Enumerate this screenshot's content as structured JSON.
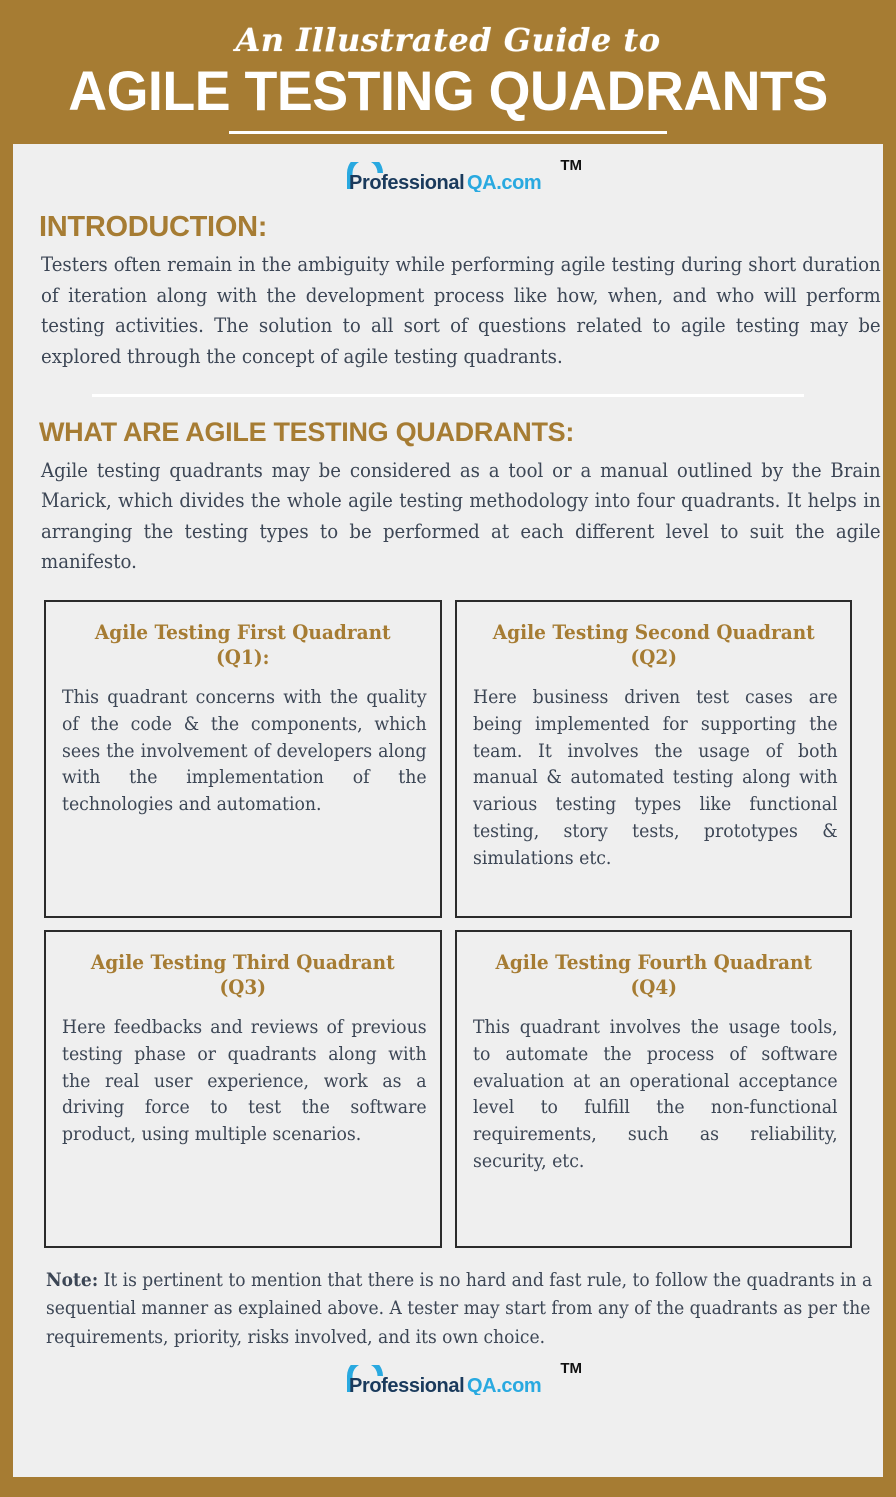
{
  "colors": {
    "gold": "#a67c33",
    "panel_bg": "#efefef",
    "body_text": "#3c4655",
    "box_border": "#2b2b2b",
    "logo_dark": "#1a3a5c",
    "logo_blue": "#29a9e0"
  },
  "header": {
    "eyebrow": "An Illustrated Guide to",
    "title": "AGILE TESTING QUADRANTS"
  },
  "logo": {
    "word_dark": "Professional",
    "word_blue": "QA.com",
    "trademark": "TM",
    "alt": "ProfessionalQA.com"
  },
  "sections": [
    {
      "heading": "INTRODUCTION:",
      "body": "Testers often remain in the ambiguity while performing agile testing during short duration of iteration along with the development process like how, when, and who will perform testing activities. The solution to all sort of questions related to agile testing may be explored through the concept of agile testing quadrants."
    },
    {
      "heading": "WHAT ARE AGILE TESTING QUADRANTS:",
      "body": "Agile testing quadrants may be considered as a tool or a manual outlined by the Brain Marick, which divides the whole agile testing methodology into four quadrants. It helps in arranging the testing types to be performed at each different level to suit the agile manifesto."
    }
  ],
  "quadrants": [
    {
      "title": "Agile Testing First Quadrant (Q1):",
      "body": "This quadrant concerns with the quality of the code & the components, which sees the involvement of developers along with the implementation of the technologies and automation."
    },
    {
      "title": "Agile Testing Second Quadrant (Q2)",
      "body": "Here business driven test cases are being implemented for supporting the team. It involves the usage of both manual & automated testing along with various testing types like functional testing, story tests, prototypes & simulations etc."
    },
    {
      "title": "Agile Testing Third Quadrant (Q3)",
      "body": "Here feedbacks and reviews of previous testing phase or quadrants along with the real user experience, work as a driving force to test the software product, using multiple scenarios."
    },
    {
      "title": "Agile Testing Fourth Quadrant (Q4)",
      "body": "This quadrant involves the usage tools, to automate the process of software evaluation at an operational acceptance level to fulfill the non-functional requirements, such as reliability, security, etc."
    }
  ],
  "note": {
    "label": "Note:",
    "text": " It is pertinent to mention that there is no hard and fast rule, to follow the quadrants in a sequential manner as explained above. A tester may start from any of the quadrants as per the requirements, priority, risks involved, and its own choice."
  }
}
